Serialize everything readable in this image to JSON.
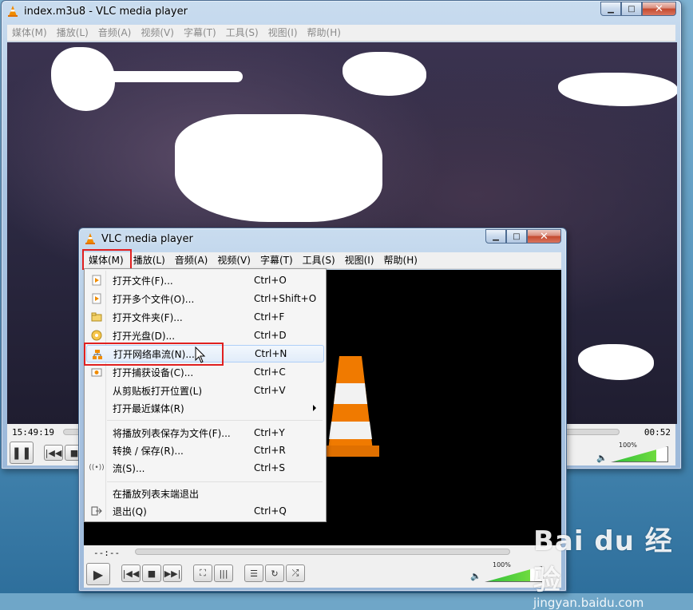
{
  "main_window": {
    "title": "index.m3u8 - VLC media player",
    "menu": [
      "媒体(M)",
      "播放(L)",
      "音频(A)",
      "视频(V)",
      "字幕(T)",
      "工具(S)",
      "视图(I)",
      "帮助(H)"
    ],
    "time_elapsed": "15:49:19",
    "time_remaining": "00:52",
    "volume": "100%"
  },
  "second_window": {
    "title": "VLC media player",
    "menu": [
      "媒体(M)",
      "播放(L)",
      "音频(A)",
      "视频(V)",
      "字幕(T)",
      "工具(S)",
      "视图(I)",
      "帮助(H)"
    ],
    "time_elapsed": "--:--",
    "volume": "100%"
  },
  "media_menu": {
    "items": [
      {
        "label": "打开文件(F)...",
        "shortcut": "Ctrl+O",
        "icon": "file-icon"
      },
      {
        "label": "打开多个文件(O)...",
        "shortcut": "Ctrl+Shift+O",
        "icon": "files-icon"
      },
      {
        "label": "打开文件夹(F)...",
        "shortcut": "Ctrl+F",
        "icon": "folder-icon"
      },
      {
        "label": "打开光盘(D)...",
        "shortcut": "Ctrl+D",
        "icon": "disc-icon"
      },
      {
        "label": "打开网络串流(N)...",
        "shortcut": "Ctrl+N",
        "icon": "network-icon",
        "highlighted": true
      },
      {
        "label": "打开捕获设备(C)...",
        "shortcut": "Ctrl+C",
        "icon": "capture-icon"
      },
      {
        "label": "从剪贴板打开位置(L)",
        "shortcut": "Ctrl+V",
        "icon": ""
      },
      {
        "label": "打开最近媒体(R)",
        "shortcut": "",
        "icon": "",
        "submenu": true
      },
      {
        "label": "将播放列表保存为文件(F)...",
        "shortcut": "Ctrl+Y",
        "icon": ""
      },
      {
        "label": "转换 / 保存(R)...",
        "shortcut": "Ctrl+R",
        "icon": ""
      },
      {
        "label": "流(S)...",
        "shortcut": "Ctrl+S",
        "icon": "stream-icon"
      },
      {
        "label": "在播放列表末端退出",
        "shortcut": "",
        "icon": ""
      },
      {
        "label": "退出(Q)",
        "shortcut": "Ctrl+Q",
        "icon": "exit-icon"
      }
    ]
  },
  "watermark": {
    "logo": "Bai du 经验",
    "url": "jingyan.baidu.com"
  }
}
